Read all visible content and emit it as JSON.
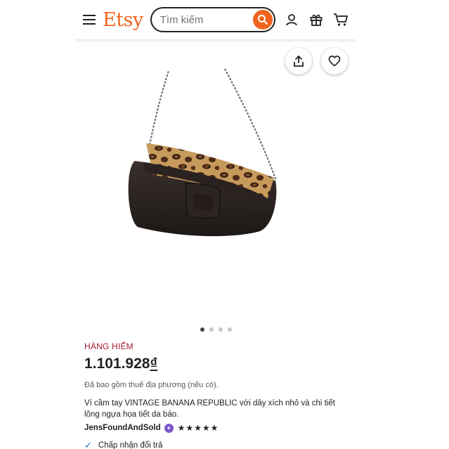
{
  "header": {
    "logo": "Etsy",
    "search_placeholder": "Tìm kiếm",
    "icons": [
      "menu-icon",
      "search-icon",
      "account-icon",
      "gift-icon",
      "cart-icon"
    ]
  },
  "gallery": {
    "image_count": 4,
    "active_index": 0,
    "actions": [
      "share-icon",
      "heart-icon"
    ]
  },
  "product": {
    "badge": "HÀNG HIẾM",
    "price_number": "1.101.928",
    "price_currency": "₫",
    "tax_note": "Đã bao gồm thuế địa phương (nếu có).",
    "description": "Ví cầm tay VINTAGE BANANA REPUBLIC với dây xích nhỏ và chi tiết lông ngựa họa tiết da báo.",
    "seller": "JensFoundAndSold",
    "rating_stars": "★★★★★",
    "rating_value": 5,
    "returns": "Chấp nhận đổi trả"
  },
  "colors": {
    "brand": "#f1641e",
    "rare_label": "#a61a2e",
    "star_seller_badge": "#7f57c9"
  }
}
